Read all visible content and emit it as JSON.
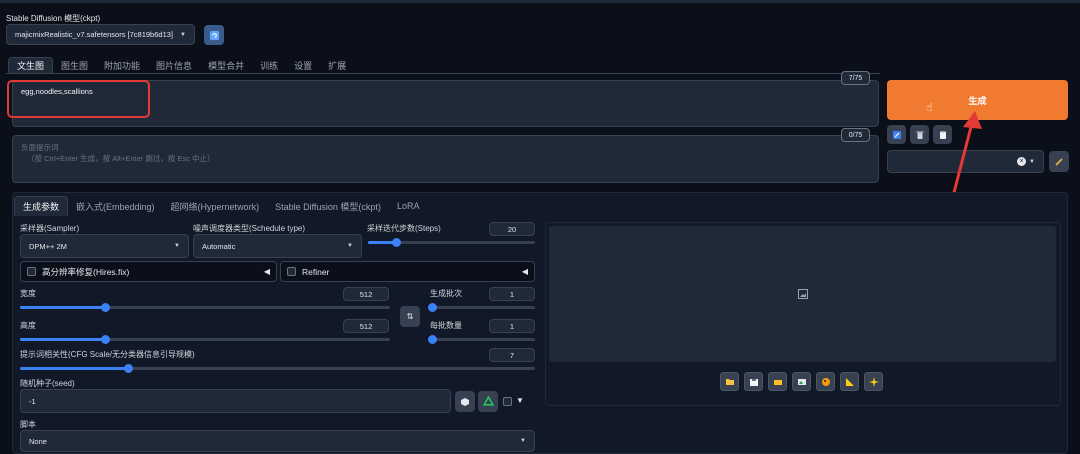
{
  "model": {
    "label": "Stable Diffusion 模型(ckpt)",
    "value": "majicmixRealistic_v7.safetensors [7c819b6d13]",
    "refresh_icon": "refresh-icon"
  },
  "main_tabs": [
    "文生图",
    "图生图",
    "附加功能",
    "图片信息",
    "模型合并",
    "训练",
    "设置",
    "扩展"
  ],
  "prompt": {
    "value": "egg,noodles,scallions",
    "counter": "7/75"
  },
  "negative_prompt": {
    "placeholder_line1": "负面提示词",
    "placeholder_line2": "（按 Ctrl+Enter 生成，按 Alt+Enter 跳过，按 Esc 中止）",
    "counter": "0/75"
  },
  "generate": {
    "label": "生成",
    "color": "#f07a30"
  },
  "tool_icons": [
    "pencil-icon",
    "trash-icon",
    "clipboard-icon"
  ],
  "style_select": {
    "clear_icon": "x-circle-icon"
  },
  "sub_tabs": [
    "生成参数",
    "嵌入式(Embedding)",
    "超网络(Hypernetwork)",
    "Stable Diffusion 模型(ckpt)",
    "LoRA"
  ],
  "sampler": {
    "label": "采样器(Sampler)",
    "value": "DPM++ 2M"
  },
  "schedule": {
    "label": "噪声调度器类型(Schedule type)",
    "value": "Automatic"
  },
  "steps": {
    "label": "采样迭代步数(Steps)",
    "value": "20",
    "fraction": 0.17
  },
  "hires": {
    "label": "高分辨率修复(Hires.fix)"
  },
  "refiner": {
    "label": "Refiner"
  },
  "width": {
    "label": "宽度",
    "value": "512",
    "fraction": 0.23
  },
  "height": {
    "label": "高度",
    "value": "512",
    "fraction": 0.23
  },
  "batch_count": {
    "label": "生成批次",
    "value": "1",
    "fraction": 0.0
  },
  "batch_size": {
    "label": "每批数量",
    "value": "1",
    "fraction": 0.0
  },
  "cfg": {
    "label": "提示词相关性(CFG Scale/无分类器信息引导规模)",
    "value": "7",
    "fraction": 0.21
  },
  "seed": {
    "label": "随机种子(seed)",
    "value": "-1"
  },
  "script": {
    "label": "脚本",
    "value": "None"
  },
  "output_icons": [
    "folder-icon",
    "save-icon",
    "zip-icon",
    "image-icon",
    "palette-icon",
    "ruler-icon",
    "sparkle-icon"
  ]
}
